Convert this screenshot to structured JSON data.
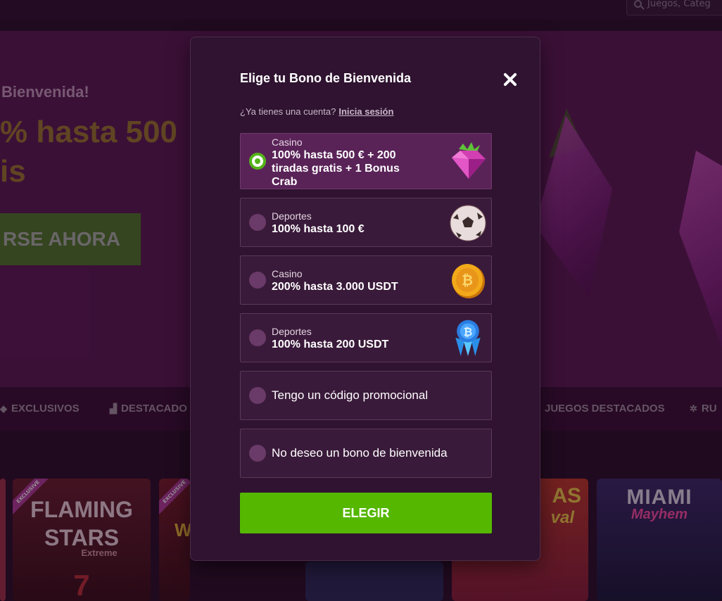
{
  "header": {
    "search_placeholder": "Juegos, Categ"
  },
  "hero": {
    "welcome": "Bienvenida!",
    "headline_1": "% hasta 500",
    "headline_2": "is",
    "cta": "RSE AHORA"
  },
  "categories": [
    {
      "label": "EXCLUSIVOS",
      "icon": "diamond-icon"
    },
    {
      "label": "DESTACADO",
      "icon": "podium-icon"
    },
    {
      "label": "JUEGOS DESTACADOS",
      "icon": ""
    },
    {
      "label": "RU",
      "icon": "roulette-icon"
    }
  ],
  "games": [
    {
      "title_1": "FLAMING",
      "title_2": "STARS",
      "subtitle": "Extreme",
      "badge": "EXCLUSIVE"
    },
    {
      "title_1": "W",
      "badge": "EXCLUSIVE"
    },
    {
      "title_1": "AS",
      "title_2": "val"
    },
    {
      "title_1": "MIAMI",
      "title_2": "Mayhem"
    }
  ],
  "modal": {
    "title": "Elige tu Bono de Bienvenida",
    "account_question": "¿Ya tienes una cuenta?",
    "login_link": "Inicia sesión",
    "options": [
      {
        "category": "Casino",
        "description": "100% hasta 500 € + 200 tiradas gratis + 1 Bonus Crab",
        "icon": "pink-gem-icon",
        "selected": true
      },
      {
        "category": "Deportes",
        "description": "100% hasta 100 €",
        "icon": "soccer-ball-icon",
        "selected": false
      },
      {
        "category": "Casino",
        "description": "200% hasta 3.000 USDT",
        "icon": "bitcoin-coin-icon",
        "selected": false
      },
      {
        "category": "Deportes",
        "description": "100% hasta 200 USDT",
        "icon": "bitcoin-crystal-icon",
        "selected": false
      },
      {
        "label": "Tengo un código promocional",
        "selected": false
      },
      {
        "label": "No deseo un bono de bienvenida",
        "selected": false
      }
    ],
    "submit": "ELEGIR"
  },
  "colors": {
    "accent_green": "#55b700",
    "modal_bg": "#2f1330",
    "selected_option_bg": "#5a2358"
  }
}
